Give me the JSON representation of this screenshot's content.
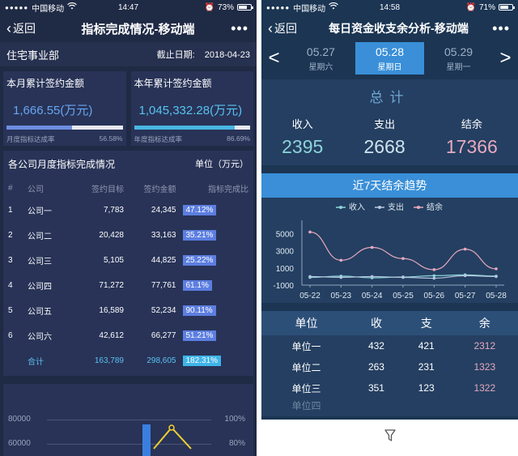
{
  "left": {
    "status": {
      "carrier": "中国移动",
      "time": "14:47",
      "battery": "73%",
      "battery_level": 0.73
    },
    "nav": {
      "back_label": "返回",
      "title": "指标完成情况-移动端"
    },
    "dept": {
      "name": "住宅事业部",
      "date_label": "截止日期:",
      "date": "2018-04-23"
    },
    "kpi_month": {
      "label": "本月累计签约金额",
      "value": "1,666.55(万元)",
      "rate_label": "月度指标达成率",
      "rate": "56.58%",
      "rate_fraction": 0.5658
    },
    "kpi_year": {
      "label": "本年累计签约金额",
      "value": "1,045,332.28(万元)",
      "rate_label": "年度指标达成率",
      "rate": "86.69%",
      "rate_fraction": 0.8669
    },
    "table": {
      "title": "各公司月度指标完成情况",
      "unit": "单位（万元）",
      "headers": [
        "#",
        "公司",
        "签约目标",
        "签约金额",
        "指标完成比"
      ],
      "rows": [
        [
          "1",
          "公司一",
          "7,783",
          "24,345",
          "47.12%"
        ],
        [
          "2",
          "公司二",
          "20,428",
          "33,163",
          "35.21%"
        ],
        [
          "3",
          "公司三",
          "5,105",
          "44,825",
          "25.22%"
        ],
        [
          "4",
          "公司四",
          "71,272",
          "77,761",
          "61.1%"
        ],
        [
          "5",
          "公司五",
          "16,589",
          "52,234",
          "90.11%"
        ],
        [
          "6",
          "公司六",
          "42,612",
          "66,277",
          "51.21%"
        ]
      ],
      "total": [
        "",
        "合计",
        "163,789",
        "298,605",
        "182.31%"
      ]
    },
    "mini_chart": {
      "y_left": [
        "80000",
        "60000"
      ],
      "y_right": [
        "100%",
        "80%"
      ],
      "bar_color": "#3a7fe0",
      "line_color": "#f2d12e"
    }
  },
  "right": {
    "status": {
      "carrier": "中国移动",
      "time": "14:58",
      "battery": "71%",
      "battery_level": 0.71
    },
    "nav": {
      "back_label": "返回",
      "title": "每日资金收支余分析-移动端"
    },
    "dates": [
      {
        "date": "05.27",
        "weekday": "星期六"
      },
      {
        "date": "05.28",
        "weekday": "星期日"
      },
      {
        "date": "05.29",
        "weekday": "星期一"
      }
    ],
    "arrows": {
      "prev": "<",
      "next": ">"
    },
    "summary": {
      "title": "总计",
      "income_label": "收入",
      "income": "2395",
      "expense_label": "支出",
      "expense": "2668",
      "balance_label": "结余",
      "balance": "17366"
    },
    "trend_title": "近7天结余趋势",
    "table": {
      "headers": [
        "单位",
        "收",
        "支",
        "余"
      ],
      "rows": [
        [
          "单位一",
          "432",
          "421",
          "2312"
        ],
        [
          "单位二",
          "263",
          "231",
          "1323"
        ],
        [
          "单位三",
          "351",
          "123",
          "1322"
        ]
      ],
      "cut_row": "单位四"
    }
  },
  "chart_data": {
    "type": "line",
    "title": "近7天结余趋势",
    "x": [
      "05-22",
      "05-23",
      "05-24",
      "05-25",
      "05-26",
      "05-27",
      "05-28"
    ],
    "ylim": [
      -1000,
      6000
    ],
    "yticks": [
      "5000",
      "3000",
      "1000",
      "-1000"
    ],
    "legend_position": "top",
    "series": [
      {
        "name": "收入",
        "color": "#8cd4da",
        "values": [
          -100,
          50,
          -150,
          -50,
          100,
          200,
          50
        ]
      },
      {
        "name": "支出",
        "color": "#b6c6e0",
        "values": [
          0,
          -100,
          0,
          -100,
          -200,
          100,
          0
        ]
      },
      {
        "name": "结余",
        "color": "#e7a9bf",
        "values": [
          5200,
          1900,
          3400,
          2100,
          800,
          3200,
          900
        ]
      }
    ]
  }
}
